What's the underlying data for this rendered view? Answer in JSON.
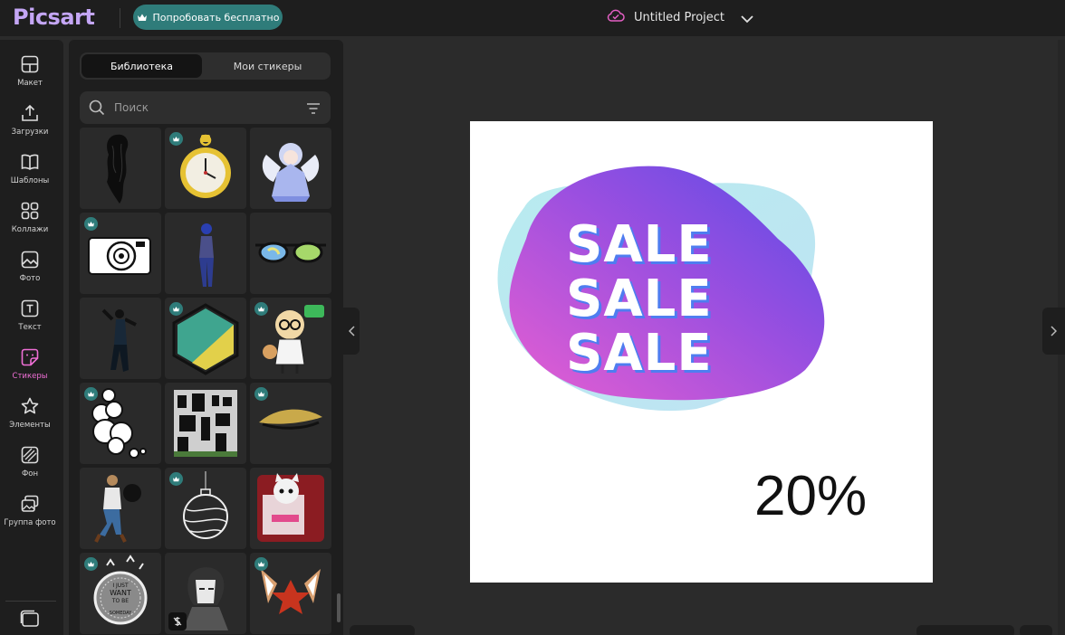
{
  "app": {
    "logo": "Picsart",
    "try_button": "Попробовать бесплатно",
    "project_title": "Untitled Project"
  },
  "rail": [
    {
      "label": "Макет",
      "icon": "layout-icon"
    },
    {
      "label": "Загрузки",
      "icon": "upload-icon"
    },
    {
      "label": "Шаблоны",
      "icon": "book-icon"
    },
    {
      "label": "Коллажи",
      "icon": "collage-icon"
    },
    {
      "label": "Фото",
      "icon": "photo-icon"
    },
    {
      "label": "Текст",
      "icon": "text-icon"
    },
    {
      "label": "Стикеры",
      "icon": "sticker-icon",
      "active": true
    },
    {
      "label": "Элементы",
      "icon": "star-icon"
    },
    {
      "label": "Фон",
      "icon": "background-icon"
    },
    {
      "label": "Группа фото",
      "icon": "photo-group-icon"
    }
  ],
  "panel": {
    "tabs": [
      "Библиотека",
      "Мои стикеры"
    ],
    "active_tab": "Библиотека",
    "search_placeholder": "Поиск"
  },
  "stickers": [
    {
      "name": "black-hair-sticker",
      "premium": false
    },
    {
      "name": "yellow-stopwatch-sticker",
      "premium": true
    },
    {
      "name": "anime-angel-girl-sticker",
      "premium": false
    },
    {
      "name": "retro-camera-sticker",
      "premium": true
    },
    {
      "name": "blue-figure-sticker",
      "premium": false
    },
    {
      "name": "sunglasses-sticker",
      "premium": false
    },
    {
      "name": "dancer-silhouette-sticker",
      "premium": false
    },
    {
      "name": "teal-hexagon-sticker",
      "premium": true
    },
    {
      "name": "cartoon-girl-with-dog-sticker",
      "premium": true
    },
    {
      "name": "white-cloud-sticker",
      "premium": true
    },
    {
      "name": "building-sticker",
      "premium": false
    },
    {
      "name": "gold-eyelash-sticker",
      "premium": true
    },
    {
      "name": "man-with-shadow-sticker",
      "premium": false
    },
    {
      "name": "christmas-ornament-sticker",
      "premium": true
    },
    {
      "name": "cat-photo-sticker",
      "premium": false
    },
    {
      "name": "want-to-be-badge-sticker",
      "premium": true,
      "badge_text": [
        "I JUST",
        "WANT",
        "TO BE",
        "SOMEDAY"
      ]
    },
    {
      "name": "anime-boy-sketch-sticker",
      "premium": false,
      "paid": true
    },
    {
      "name": "fox-ears-leaf-sticker",
      "premium": true
    }
  ],
  "canvas": {
    "sale_lines": [
      "SALE",
      "SALE",
      "SALE"
    ],
    "percent": "20%"
  },
  "colors": {
    "brand": "#c4a6f5",
    "accent_teal": "#2f7c7a",
    "active_pink": "#f06fd6",
    "blob_pink": "#e75fd1",
    "blob_purple": "#6a4ce6",
    "blob_cyan": "#a6eaea"
  }
}
